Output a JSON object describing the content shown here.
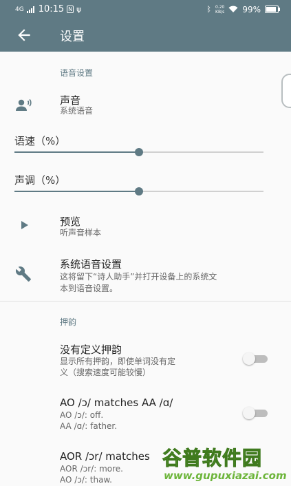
{
  "status_bar": {
    "network": "4G",
    "time": "10:15",
    "notif_badge": "N",
    "net_speed_value": "0.20",
    "net_speed_unit": "KB/s",
    "battery": "99%"
  },
  "app_bar": {
    "back_icon": "arrow-left-icon",
    "title": "设置"
  },
  "voice_section": {
    "header": "语音设置",
    "voice": {
      "title": "声音",
      "subtitle": "系统语音",
      "icon": "voice-person-icon"
    },
    "speed": {
      "label": "语速（%）",
      "value_fraction": 0.5
    },
    "pitch": {
      "label": "声调（%）",
      "value_fraction": 0.5
    },
    "preview": {
      "title": "预览",
      "subtitle": "听声音样本",
      "icon": "play-icon"
    },
    "system_tts": {
      "title": "系统语音设置",
      "subtitle_line1": "这将留下“诗人助手”并打开设备上的系统文",
      "subtitle_line2": "本到语音设置。",
      "icon": "wrench-icon"
    }
  },
  "rhyme_section": {
    "header": "押韵",
    "undefined_rhymes": {
      "title": "没有定义押韵",
      "subtitle_line1": "显示所有押韵，即使单词没有定",
      "subtitle_line2": "义（搜索速度可能较慢）",
      "enabled": false
    },
    "ao_aa": {
      "title": "AO /ɔ/ matches AA /ɑ/",
      "line1": "AO /ɔ/: off.",
      "line2": "AA /ɑ/: father.",
      "enabled": false
    },
    "aor": {
      "title": "AOR /ɔr/ matches",
      "line1": "AOR /ɔr/: more.",
      "line2": "AO /ɔ/: thaw."
    }
  },
  "watermark": {
    "title": "谷普软件园",
    "url": "www.gupuxiazai.com"
  },
  "colors": {
    "primary": "#5f7a84",
    "background": "#fafafa"
  }
}
